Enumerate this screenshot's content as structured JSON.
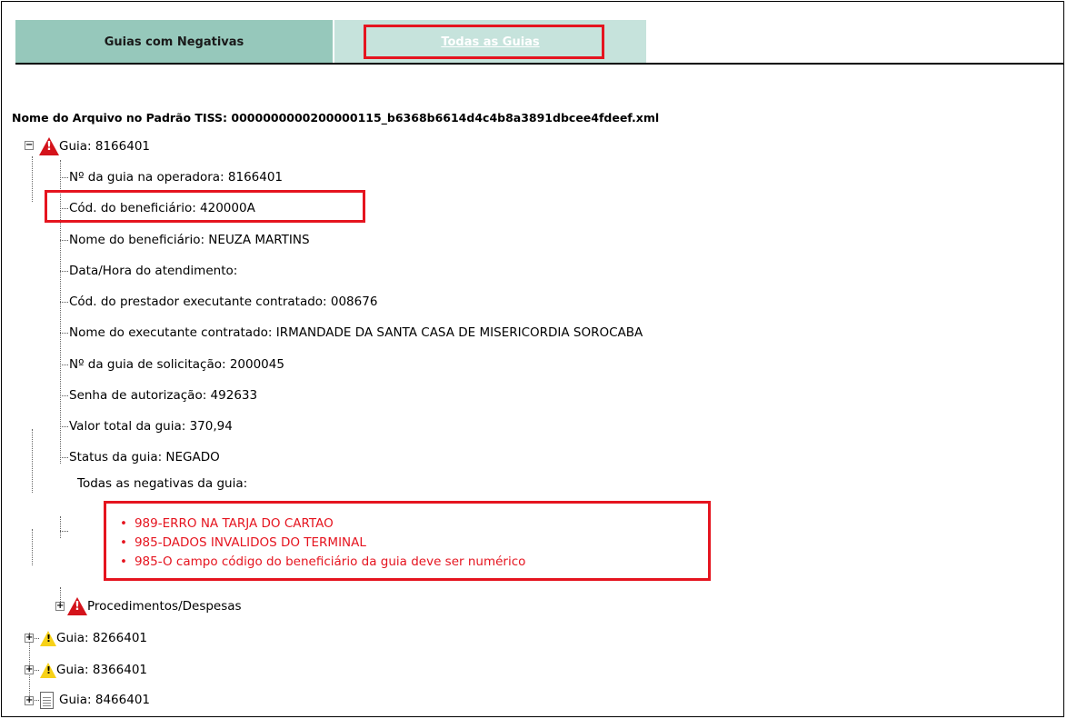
{
  "tabs": {
    "negatives_label": "Guias com Negativas",
    "all_label": "Todas as Guias"
  },
  "file": {
    "label": "Nome do Arquivo no Padrão TISS: 0000000000200000115_b6368b6614d4c4b8a3891dbcee4fdeef.xml"
  },
  "guia_main": {
    "title": "Guia: 8166401",
    "fields": [
      "Nº da guia na operadora: 8166401",
      "Cód. do beneficiário: 420000A",
      "Nome do beneficiário: NEUZA MARTINS",
      "Data/Hora do atendimento:",
      "Cód. do prestador executante contratado: 008676",
      "Nome do executante contratado: IRMANDADE DA SANTA CASA DE MISERICORDIA SOROCABA",
      "Nº da guia de solicitação: 2000045",
      "Senha de autorização: 492633",
      "Valor total da guia: 370,94",
      "Status da guia: NEGADO"
    ],
    "negatives_heading": "Todas as negativas da guia:",
    "negatives": [
      "989-ERRO NA TARJA DO CARTAO",
      "985-DADOS INVALIDOS DO TERMINAL",
      "985-O campo código do beneficiário da guia deve ser numérico"
    ],
    "procedures_label": "Procedimentos/Despesas"
  },
  "other_guias": [
    {
      "title": "Guia: 8266401",
      "icon": "warning-yellow-icon"
    },
    {
      "title": "Guia: 8366401",
      "icon": "warning-yellow-icon"
    },
    {
      "title": "Guia: 8466401",
      "icon": "document-icon"
    }
  ],
  "colors": {
    "tab_active": "#96c8bb",
    "tab_inactive": "#c6e3dc",
    "highlight_red": "#e5141f",
    "error_red": "#e5141f"
  }
}
